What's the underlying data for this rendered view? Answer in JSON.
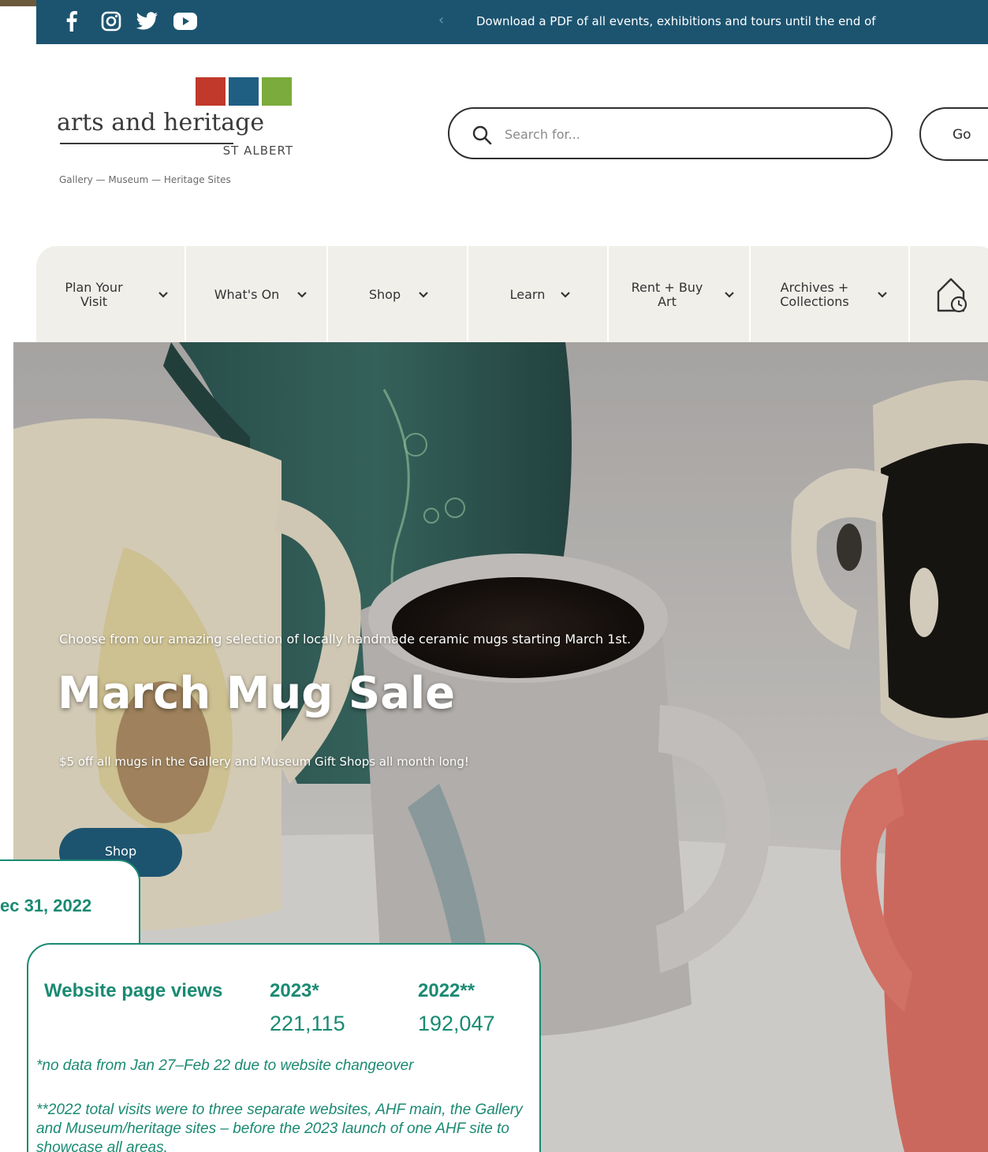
{
  "topbar": {
    "social_icons": [
      "facebook-icon",
      "instagram-icon",
      "twitter-icon",
      "youtube-icon"
    ],
    "prev_arrow": "‹",
    "announcement": "Download a PDF of all events, exhibitions and tours until the end of"
  },
  "logo": {
    "square_colors": [
      "#c0392b",
      "#1f5f82",
      "#7bab3c"
    ],
    "name": "arts and heritage",
    "city": "ST ALBERT",
    "tagline": "Gallery — Museum — Heritage Sites"
  },
  "search": {
    "placeholder": "Search for...",
    "button_label": "Go"
  },
  "nav": {
    "items": [
      {
        "label": "Plan Your\nVisit",
        "has_dropdown": true
      },
      {
        "label": "What's On",
        "has_dropdown": true
      },
      {
        "label": "Shop",
        "has_dropdown": true
      },
      {
        "label": "Learn",
        "has_dropdown": true
      },
      {
        "label": "Rent + Buy\nArt",
        "has_dropdown": true
      },
      {
        "label": "Archives +\nCollections",
        "has_dropdown": true
      }
    ],
    "hours_icon": "home-clock-icon"
  },
  "hero": {
    "eyebrow": "Choose from our amazing selection of locally handmade ceramic mugs starting March 1st.",
    "title": "March Mug Sale",
    "subtitle": "$5 off all mugs in the Gallery and Museum Gift Shops all month long!",
    "button_label": "Shop"
  },
  "overlay": {
    "back_card_text": "ec 31, 2022",
    "stat": {
      "label": "Website page views",
      "columns": [
        {
          "year": "2023*",
          "value": "221,115"
        },
        {
          "year": "2022**",
          "value": "192,047"
        }
      ],
      "note_1": "*no data from Jan 27–Feb 22 due to website changeover",
      "note_2": "**2022 total visits were to three separate websites, AHF main, the Gallery and Museum/heritage sites – before the 2023 launch of one AHF site to showcase all areas."
    }
  },
  "colors": {
    "brand_blue": "#1c5470",
    "report_green": "#1a8a72",
    "nav_bg": "#f1efea"
  }
}
